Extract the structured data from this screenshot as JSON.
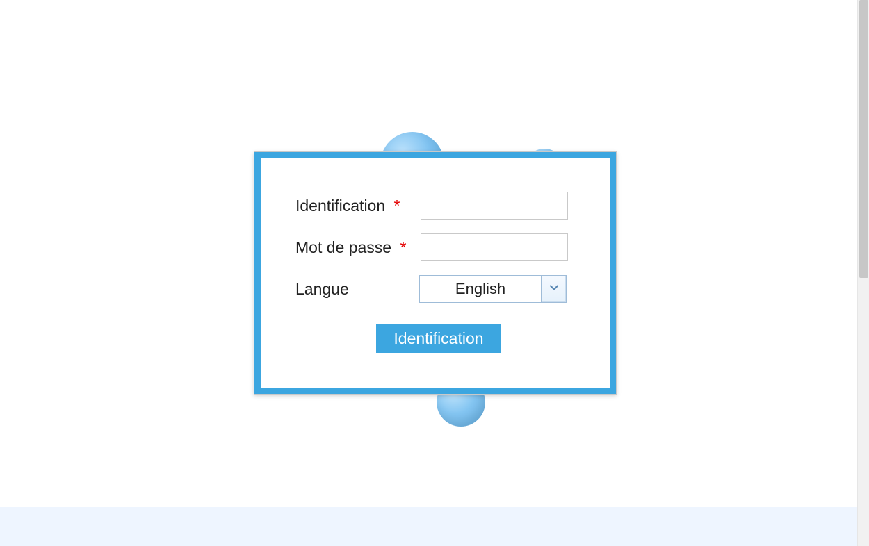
{
  "login": {
    "fields": {
      "identification": {
        "label": "Identification",
        "required_mark": "*",
        "value": ""
      },
      "password": {
        "label": "Mot de passe",
        "required_mark": "*",
        "value": ""
      },
      "language": {
        "label": "Langue",
        "selected": "English"
      }
    },
    "submit_label": "Identification"
  },
  "colors": {
    "accent": "#3ca6e0",
    "required": "#e40000"
  }
}
